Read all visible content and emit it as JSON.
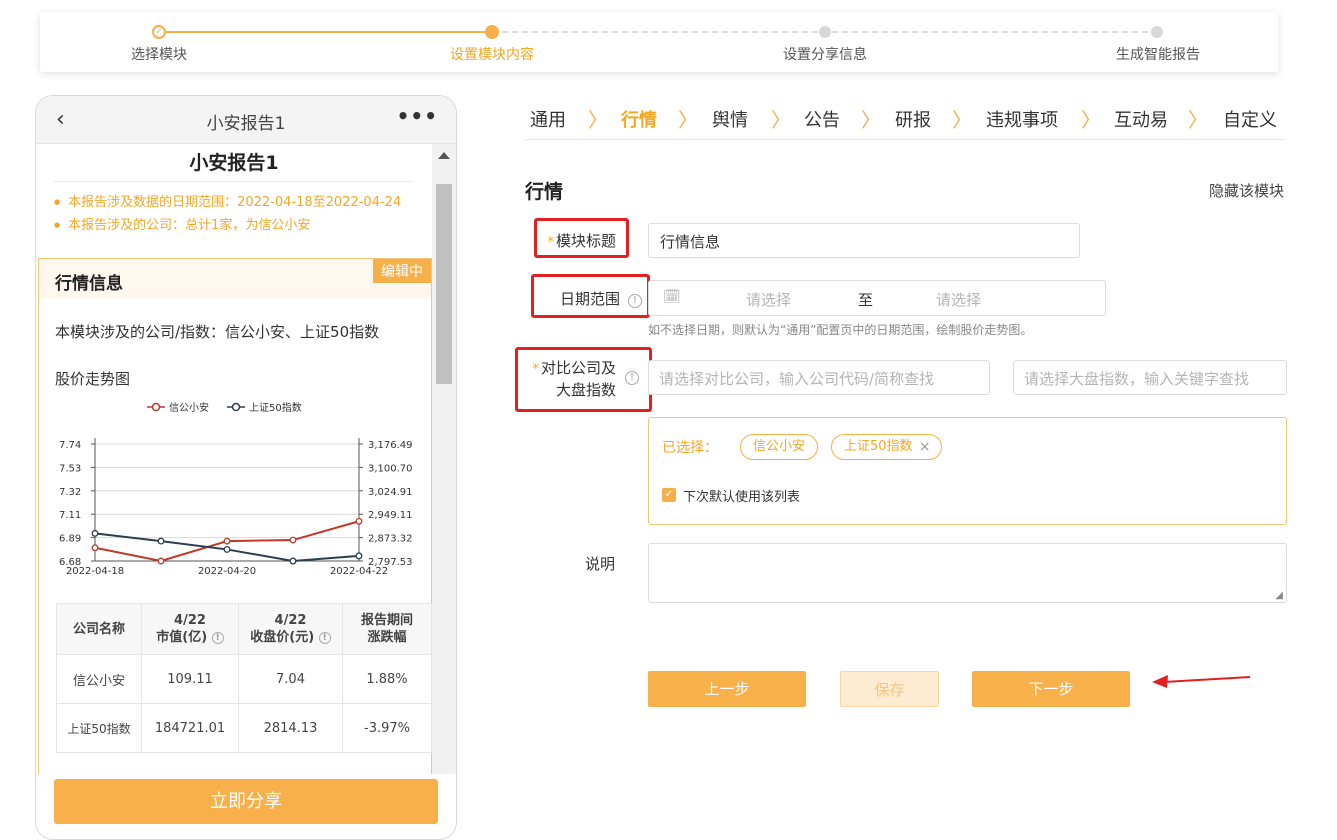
{
  "stepper": {
    "steps": [
      "选择模块",
      "设置模块内容",
      "设置分享信息",
      "生成智能报告"
    ]
  },
  "phone": {
    "nav_title": "小安报告1",
    "report_title": "小安报告1",
    "bullets": [
      "本报告涉及数据的日期范围：2022-04-18至2022-04-24",
      "本报告涉及的公司：总计1家，为信公小安"
    ],
    "module": {
      "name": "行情信息",
      "badge": "编辑中",
      "desc": "本模块涉及的公司/指数：信公小安、上证50指数",
      "chart_caption": "股价走势图"
    },
    "table": {
      "headers": [
        [
          "公司名称"
        ],
        [
          "4/22",
          "市值(亿)"
        ],
        [
          "4/22",
          "收盘价(元)"
        ],
        [
          "报告期间",
          "涨跌幅"
        ]
      ],
      "rows": [
        [
          "信公小安",
          "109.11",
          "7.04",
          "1.88%"
        ],
        [
          "上证50指数",
          "184721.01",
          "2814.13",
          "-3.97%"
        ]
      ]
    },
    "share_button": "立即分享"
  },
  "chart_data": {
    "type": "line",
    "x": [
      "2022-04-18",
      "2022-04-19",
      "2022-04-20",
      "2022-04-21",
      "2022-04-22"
    ],
    "x_tick_labels": [
      "2022-04-18",
      "2022-04-20",
      "2022-04-22"
    ],
    "y_left_ticks": [
      "7.74",
      "7.53",
      "7.32",
      "7.11",
      "6.89",
      "6.68"
    ],
    "y_right_ticks": [
      "3,176.49",
      "3,100.70",
      "3,024.91",
      "2,949.11",
      "2,873.32",
      "2,797.53"
    ],
    "y_left_lim": [
      6.68,
      7.74
    ],
    "y_right_lim": [
      2797.53,
      3176.49
    ],
    "series": [
      {
        "name": "信公小安",
        "axis": "left",
        "color": "#c0392b",
        "values": [
          6.8,
          6.68,
          6.86,
          6.87,
          7.04
        ]
      },
      {
        "name": "上证50指数",
        "axis": "right",
        "color": "#2c3e50",
        "values": [
          2887,
          2862,
          2835,
          2797.53,
          2814.13
        ]
      }
    ],
    "legend": "top-center",
    "grid": true
  },
  "tabs": [
    "通用",
    "行情",
    "舆情",
    "公告",
    "研报",
    "违规事项",
    "互动易",
    "自定义"
  ],
  "active_tab": "行情",
  "form": {
    "section_title": "行情",
    "hide_link": "隐藏该模块",
    "title_label": "模块标题",
    "title_value": "行情信息",
    "date_label": "日期范围",
    "date_start_placeholder": "请选择",
    "date_to": "至",
    "date_end_placeholder": "请选择",
    "date_hint": "如不选择日期，则默认为“通用”配置页中的日期范围，绘制股价走势图。",
    "compare_label_1": "对比公司及",
    "compare_label_2": "大盘指数",
    "company_placeholder": "请选择对比公司，输入公司代码/简称查找",
    "index_placeholder": "请选择大盘指数，输入关键字查找",
    "selected_label": "已选择：",
    "chips": [
      "信公小安",
      "上证50指数"
    ],
    "default_list_label": "下次默认使用该列表",
    "note_label": "说明",
    "prev_button": "上一步",
    "save_button": "保存",
    "next_button": "下一步"
  }
}
